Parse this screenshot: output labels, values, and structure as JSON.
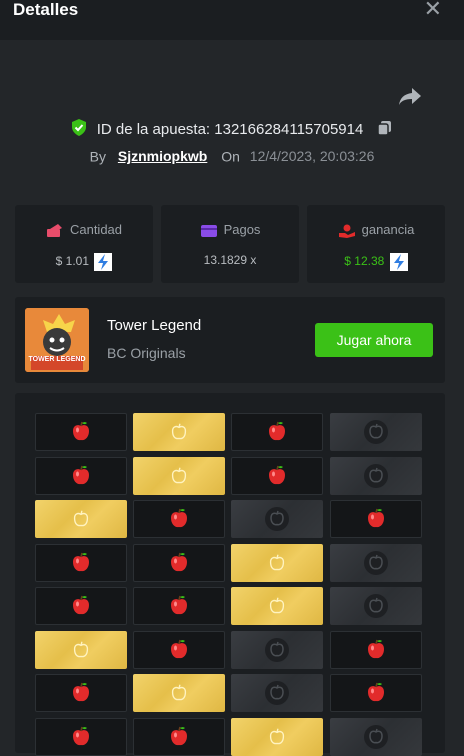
{
  "header": {
    "title": "Detalles",
    "close_label": "✕"
  },
  "bet": {
    "id_label": "ID de la apuesta: 132166284115705914",
    "by_label": "By",
    "user": "Sjznmiopkwb",
    "on_label": "On",
    "date": "12/4/2023, 20:03:26"
  },
  "stats": {
    "cantidad": {
      "label": "Cantidad",
      "value": "$ 1.01"
    },
    "pagos": {
      "label": "Pagos",
      "value": "13.1829 x"
    },
    "ganancia": {
      "label": "ganancia",
      "value": "$ 12.38"
    }
  },
  "game": {
    "name": "Tower Legend",
    "provider": "BC Originals",
    "play_label": "Jugar ahora",
    "thumb_text": "TOWER LEGEND"
  },
  "colors": {
    "accent_green": "#3bc117",
    "gold": "#e5bf4a",
    "apple_red": "#e22b2b",
    "background": "#232629",
    "panel": "#1b1e21"
  },
  "board": {
    "legend": {
      "apple": "red apple",
      "gold": "picked gold tile",
      "dark": "unrevealed dark tile"
    },
    "rows": [
      [
        "apple",
        "gold",
        "apple",
        "dark"
      ],
      [
        "apple",
        "gold",
        "apple",
        "dark"
      ],
      [
        "gold",
        "apple",
        "dark",
        "apple"
      ],
      [
        "apple",
        "apple",
        "gold",
        "dark"
      ],
      [
        "apple",
        "apple",
        "gold",
        "dark"
      ],
      [
        "gold",
        "apple",
        "dark",
        "apple"
      ],
      [
        "apple",
        "gold",
        "dark",
        "apple"
      ],
      [
        "apple",
        "apple",
        "gold",
        "dark"
      ]
    ]
  }
}
